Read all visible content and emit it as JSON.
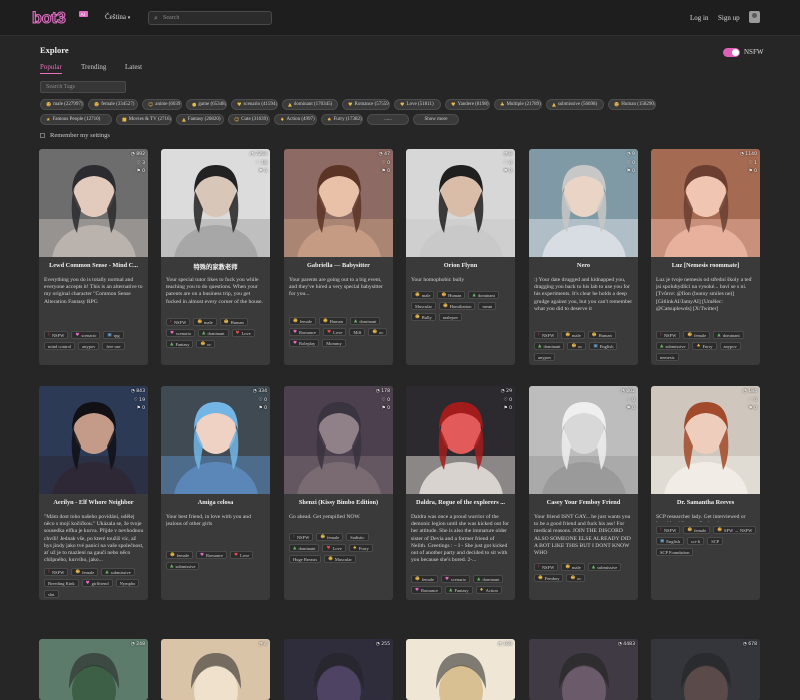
{
  "header": {
    "logo_text": "bot3",
    "logo_badge": "AI",
    "language": "Čeština",
    "search_placeholder": "Search",
    "login": "Log in",
    "signup": "Sign up"
  },
  "explore": {
    "title": "Explore",
    "nsfw_label": "NSFW",
    "nsfw_on": true,
    "tabs": [
      "Popular",
      "Trending",
      "Latest"
    ],
    "active_tab": "Popular",
    "tag_search_placeholder": "Search Tags",
    "tag_rows": [
      [
        {
          "icon": "☻",
          "label": "male (227997)"
        },
        {
          "icon": "☻",
          "label": "female (334527)"
        },
        {
          "icon": "☺",
          "label": "anime (60391)"
        },
        {
          "icon": "●",
          "label": "game (65348)"
        },
        {
          "icon": "♥",
          "label": "scenario (41594)"
        },
        {
          "icon": "▲",
          "label": "dominant (170345)"
        },
        {
          "icon": "♥",
          "label": "Romance (57559)"
        },
        {
          "icon": "♥",
          "label": "Love (51811)"
        },
        {
          "icon": "♥",
          "label": "Yandere (8198)"
        },
        {
          "icon": "♣",
          "label": "Multiple (21789)"
        },
        {
          "icon": "▲",
          "label": "submissive (56698)"
        },
        {
          "icon": "☻",
          "label": "Human (158290)"
        }
      ],
      [
        {
          "icon": "★",
          "label": "Famous People (12710)"
        },
        {
          "icon": "■",
          "label": "Movies & TV (2716)"
        },
        {
          "icon": "▲",
          "label": "Fantasy (20820)"
        },
        {
          "icon": "☺",
          "label": "Cute (31639)"
        },
        {
          "icon": "♦",
          "label": "Action (4997)"
        },
        {
          "icon": "♠",
          "label": "Furry (17382)"
        },
        {
          "icon": "",
          "label": "......"
        },
        {
          "icon": "",
          "label": "Show more"
        }
      ]
    ],
    "remember_label": "Remember my settings"
  },
  "cards": [
    {
      "name": "Lewd Common Sense - Mind C...",
      "stats": [
        "◔ 892",
        "♡ 3",
        "⚑ 0"
      ],
      "desc": "Everything you do is totally normal and everyone accepts it! This is an alternative to my original character \"Common Sense Alteration Fantasy RPG",
      "tags": [
        [
          "!",
          "NSFW",
          "red"
        ],
        [
          "♥",
          "scenario",
          "pnk"
        ],
        [
          "▣",
          "rpg",
          "blu"
        ],
        [
          "",
          "mind control",
          ""
        ],
        [
          "",
          "anypov",
          ""
        ],
        [
          "",
          "free use",
          ""
        ]
      ]
    },
    {
      "name": "特殊的家教老师",
      "stats": [
        "◔ 7264",
        "♡ 18",
        "⚑ 0"
      ],
      "desc": "Your special tutor likes to fuck you while teaching you to do questions. When your parents are on a business trip, you get fucked in almost every corner of the house.",
      "tags": [
        [
          "!",
          "NSFW",
          "red"
        ],
        [
          "☻",
          "male",
          ""
        ],
        [
          "☻",
          "Human",
          ""
        ],
        [
          "♥",
          "scenario",
          "pnk"
        ],
        [
          "▲",
          "dominant",
          "grn"
        ],
        [
          "♥",
          "Love",
          "red"
        ],
        [
          "▲",
          "Fantasy",
          "grn"
        ],
        [
          "☻",
          "oc",
          ""
        ]
      ]
    },
    {
      "name": "Gabriella — Babysitter",
      "stats": [
        "◔ 47",
        "♡ 0",
        "⚑ 0"
      ],
      "desc": "Your parents are going out to a big event, and they've hired a very special babysitter for you...",
      "tags": [
        [
          "☻",
          "female",
          ""
        ],
        [
          "☻",
          "Human",
          ""
        ],
        [
          "▲",
          "dominant",
          "grn"
        ],
        [
          "♥",
          "Romance",
          "pnk"
        ],
        [
          "♥",
          "Love",
          "red"
        ],
        [
          "",
          "Milf",
          ""
        ],
        [
          "☻",
          "oc",
          ""
        ],
        [
          "♥",
          "Roleplay",
          "pnk"
        ],
        [
          "",
          "Mommy",
          ""
        ]
      ]
    },
    {
      "name": "Orion Flynn",
      "stats": [
        "◔ 8",
        "♡ 0",
        "⚑ 0"
      ],
      "desc": "Your homophobic bully",
      "tags": [
        [
          "☻",
          "male",
          ""
        ],
        [
          "☻",
          "Human",
          ""
        ],
        [
          "▲",
          "dominant",
          "grn"
        ],
        [
          "",
          "Muscular",
          ""
        ],
        [
          "☻",
          "Humiliation",
          ""
        ],
        [
          "",
          "mean",
          ""
        ],
        [
          "☻",
          "Bully",
          ""
        ],
        [
          "",
          "malepov",
          ""
        ]
      ]
    },
    {
      "name": "Nero",
      "stats": [
        "◔ 9",
        "♡ 0",
        "⚑ 0"
      ],
      "desc": ":) Your date drugged and kidnapped you, dragging you back to his lab to use you for his experiments. It's clear he holds a deep grudge against you, but you can't remember what you did to deserve it",
      "tags": [
        [
          "!",
          "NSFW",
          "red"
        ],
        [
          "☻",
          "male",
          ""
        ],
        [
          "☻",
          "Human",
          ""
        ],
        [
          "▲",
          "dominant",
          "grn"
        ],
        [
          "☻",
          "oc",
          ""
        ],
        [
          "▣",
          "English",
          "blu"
        ],
        [
          "",
          "anypov",
          ""
        ]
      ]
    },
    {
      "name": "Luz [Nemesis roommate]",
      "stats": [
        "◔ 1140",
        "♡ 1",
        "⚑ 0"
      ],
      "desc": "Luz je tvoje nemesis od střední školy a teď jsi spolubydlící na vysoké... baví se s ní. [Tvůrce: @Ilon (bunny smiles ne)] [GitlinkAI/JamyAI] [Umělec: @Catsuplewds] [X/Twitter]",
      "tags": [
        [
          "!",
          "NSFW",
          "red"
        ],
        [
          "☻",
          "female",
          ""
        ],
        [
          "▲",
          "dominant",
          "grn"
        ],
        [
          "▲",
          "submissive",
          "grn"
        ],
        [
          "♠",
          "Furry",
          ""
        ],
        [
          "",
          "anypov",
          ""
        ],
        [
          "",
          "nemesis",
          ""
        ]
      ]
    },
    {
      "name": "Aerilyn - Elf Whore Neighbor",
      "stats": [
        "◔ 843",
        "♡ 19",
        "⚑ 0"
      ],
      "desc": "\"Mám dost toho našeho povídání, udělej něco s mojí kočičkou.\" Ukázala se, že tvoje sousedka elfka je kurva. Přijde v nevhodnou chvíli! Jednak vše, po které toužíš víc, až bys jindy jako tvé panici na vaše společnost, ať už je to mazlení na gauči nebo něco chlípného, kurvího, jako...",
      "tags": [
        [
          "!",
          "NSFW",
          "red"
        ],
        [
          "☻",
          "female",
          ""
        ],
        [
          "▲",
          "submissive",
          "grn"
        ],
        [
          "",
          "Breeding Kink",
          ""
        ],
        [
          "♥",
          "girlfriend",
          "pnk"
        ],
        [
          "",
          "Nympho",
          ""
        ],
        [
          "",
          "slut",
          ""
        ]
      ]
    },
    {
      "name": "Amiga celosa",
      "stats": [
        "◔ 334",
        "♡ 0",
        "⚑ 0"
      ],
      "desc": "Your best friend, in love with you and jealous of other girls",
      "tags": [
        [
          "☻",
          "female",
          ""
        ],
        [
          "♥",
          "Romance",
          "pnk"
        ],
        [
          "♥",
          "Love",
          "red"
        ],
        [
          "▲",
          "submissive",
          "grn"
        ]
      ]
    },
    {
      "name": "Shenzi (Kissy Bimbo Edition)",
      "stats": [
        "◔ 178",
        "♡ 0",
        "⚑ 0"
      ],
      "desc": "Go ahead. Get yempilled NOW.",
      "tags": [
        [
          "!",
          "NSFW",
          "red"
        ],
        [
          "☻",
          "female",
          ""
        ],
        [
          "",
          "Sadistic",
          ""
        ],
        [
          "▲",
          "dominant",
          "grn"
        ],
        [
          "♥",
          "Love",
          "red"
        ],
        [
          "♠",
          "Furry",
          ""
        ],
        [
          "",
          "Huge Breasts",
          ""
        ],
        [
          "☻",
          "Muscular",
          ""
        ]
      ]
    },
    {
      "name": "Daldra, Rogue of the explorers ...",
      "stats": [
        "◔ 29",
        "♡ 0",
        "⚑ 0"
      ],
      "desc": "Daldra was once a proud warrior of the demonic legion until she was kicked out for her attitude. She is also the immature older sister of Devia and a former friend of Nelith. Greetings : – I - She just got kicked out of another party and decided to sit with you because she's bored. 2-...",
      "tags": [
        [
          "☻",
          "female",
          ""
        ],
        [
          "♥",
          "scenario",
          "pnk"
        ],
        [
          "▲",
          "dominant",
          "grn"
        ],
        [
          "♥",
          "Romance",
          "pnk"
        ],
        [
          "▲",
          "Fantasy",
          "grn"
        ],
        [
          "♦",
          "Action",
          ""
        ]
      ]
    },
    {
      "name": "Casey Your Femboy Friend",
      "stats": [
        "◔ 802",
        "♡ 0",
        "⚑ 0"
      ],
      "desc": "Your friend ISNT GAY... he just wants you to be a good friend and fuck his ass! For medical reasons. JOIN THE DISCORD ALSO SOMEONE ELSE ALREADY DID A BOT LIKE THIS BUT I DONT KNOW WHO",
      "tags": [
        [
          "!",
          "NSFW",
          "red"
        ],
        [
          "☻",
          "male",
          ""
        ],
        [
          "▲",
          "submissive",
          "grn"
        ],
        [
          "☻",
          "Femboy",
          ""
        ],
        [
          "☻",
          "oc",
          ""
        ]
      ]
    },
    {
      "name": "Dr. Samantha Reeves",
      "stats": [
        "◔ 184",
        "♡ 0",
        "⚑ 0"
      ],
      "desc": "SCP researcher lady. Get interviewed or loved her idk man, I'm just here.",
      "tags": [
        [
          "!",
          "NSFW",
          "red"
        ],
        [
          "☻",
          "female",
          ""
        ],
        [
          "☻",
          "SFW → NSFW",
          ""
        ],
        [
          "▣",
          "English",
          "blu"
        ],
        [
          "",
          "sci-fi",
          ""
        ],
        [
          "",
          "SCP",
          ""
        ],
        [
          "",
          "SCP Foundation",
          ""
        ]
      ]
    }
  ],
  "bottom_stats": [
    "◔ 248",
    "◔ 4",
    "◔ 255",
    "◔ 168",
    "◔ 4483",
    "◔ 678"
  ]
}
